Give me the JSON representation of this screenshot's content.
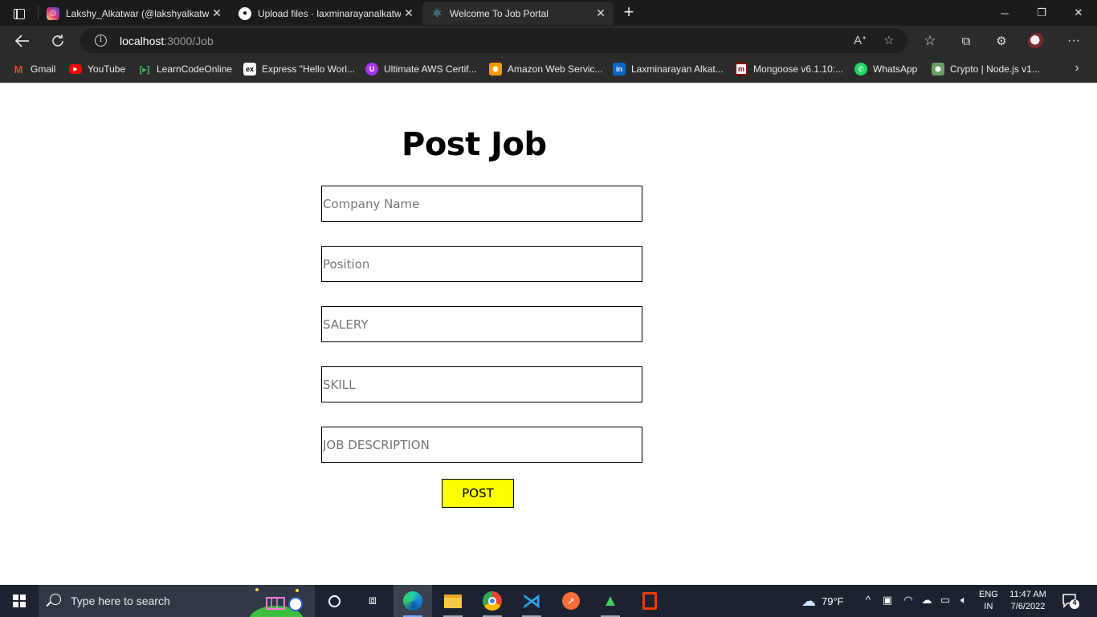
{
  "browser": {
    "tabs": [
      {
        "label": "Lakshy_Alkatwar (@lakshyalkatwar)",
        "icon": "instagram-icon",
        "active": false
      },
      {
        "label": "Upload files · laxminarayanalkatwar",
        "icon": "github-icon",
        "active": false
      },
      {
        "label": "Welcome To Job Portal",
        "icon": "react-icon",
        "active": true
      }
    ],
    "url_host": "localhost",
    "url_path": ":3000/Job",
    "bookmarks": [
      {
        "label": "Gmail",
        "icon": "gmail-icon",
        "color": "#ea4335"
      },
      {
        "label": "YouTube",
        "icon": "youtube-icon",
        "color": "#ff0000"
      },
      {
        "label": "LearnCodeOnline",
        "icon": "learncodeonline-icon",
        "color": "#1f8f3a"
      },
      {
        "label": "Express \"Hello Worl...",
        "icon": "express-icon",
        "color": "#ffffff"
      },
      {
        "label": "Ultimate AWS Certif...",
        "icon": "udemy-icon",
        "color": "#a435f0"
      },
      {
        "label": "Amazon Web Servic...",
        "icon": "aws-icon",
        "color": "#ff9900"
      },
      {
        "label": "Laxminarayan Alkat...",
        "icon": "linkedin-icon",
        "color": "#0a66c2"
      },
      {
        "label": "Mongoose v6.1.10:...",
        "icon": "mongoose-icon",
        "color": "#880000"
      },
      {
        "label": "WhatsApp",
        "icon": "whatsapp-icon",
        "color": "#25d366"
      },
      {
        "label": "Crypto | Node.js v1...",
        "icon": "nodejs-icon",
        "color": "#68a063"
      }
    ]
  },
  "page": {
    "title": "Post Job",
    "fields": [
      {
        "name": "company-name-input",
        "placeholder": "Company Name",
        "value": ""
      },
      {
        "name": "position-input",
        "placeholder": "Position",
        "value": ""
      },
      {
        "name": "salery-input",
        "placeholder": "SALERY",
        "value": ""
      },
      {
        "name": "skill-input",
        "placeholder": "SKILL",
        "value": ""
      },
      {
        "name": "job-description-input",
        "placeholder": "JOB DESCRIPTION",
        "value": ""
      }
    ],
    "post_label": "POST",
    "post_color": "#ffff00"
  },
  "taskbar": {
    "search_placeholder": "Type here to search",
    "temperature": "79°F",
    "lang_line1": "ENG",
    "lang_line2": "IN",
    "time": "11:47 AM",
    "date": "7/6/2022",
    "notification_count": "4"
  }
}
